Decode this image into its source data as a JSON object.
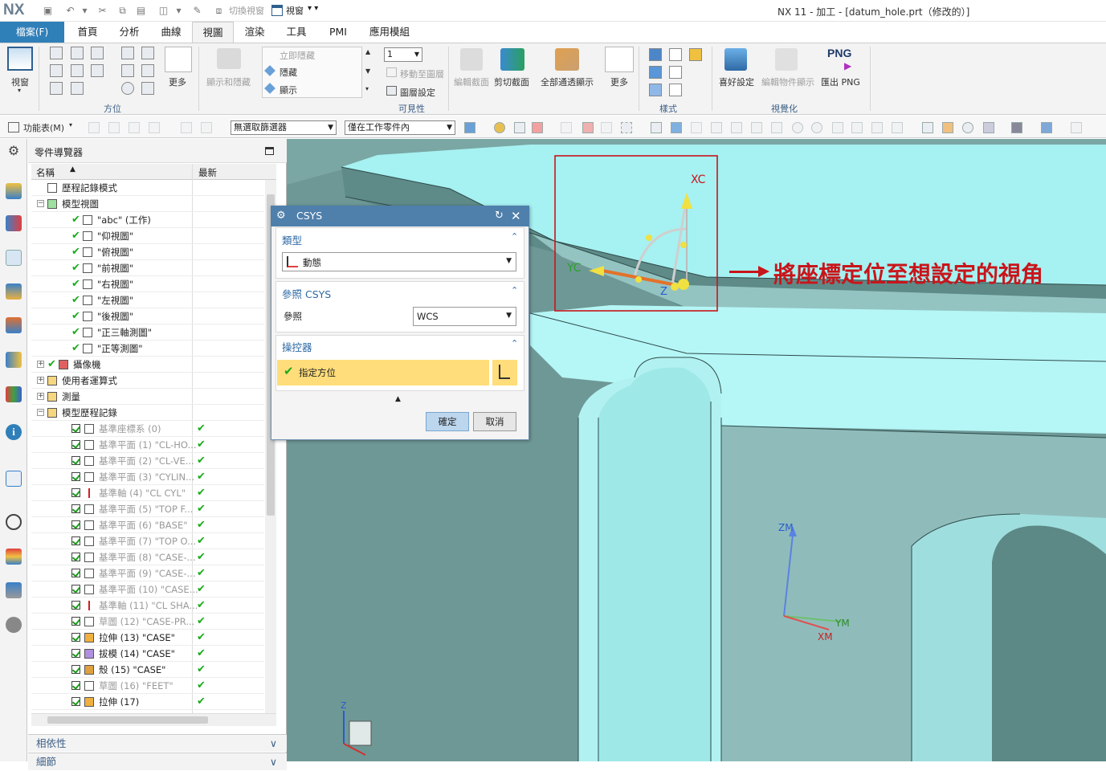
{
  "titlebar": {
    "logo": "NX",
    "quick_access": [
      "save-icon",
      "undo-icon",
      "redo-dropdown-icon",
      "cut-icon",
      "copy-icon",
      "paste-icon",
      "window-icon"
    ],
    "toggle_view_label": "切換視窗",
    "window_label": "視窗",
    "title": "NX 11 - 加工 - [datum_hole.prt（修改的）]"
  },
  "tabs": {
    "file": "檔案(F)",
    "items": [
      "首頁",
      "分析",
      "曲線",
      "視圖",
      "渲染",
      "工具",
      "PMI",
      "應用模組"
    ],
    "active": "視圖"
  },
  "ribbon": {
    "view_button": "視窗",
    "orient_group": "方位",
    "more": "更多",
    "show_hide": "顯示和隱藏",
    "immediate_hide": "立即隱藏",
    "hide": "隱藏",
    "show": "顯示",
    "layer_value": "1",
    "move_to_layer": "移動至圖層",
    "layer_settings": "圖層設定",
    "visibility_group": "可見性",
    "edit_section": "編輯截面",
    "clip_section": "剪切截面",
    "show_all_through": "全部通透顯示",
    "more2": "更多",
    "style_group": "樣式",
    "preferences": "喜好設定",
    "edit_object_display": "編輯物件顯示",
    "png_badge": "PNG",
    "export_png": "匯出 PNG",
    "visualization_group": "視覺化"
  },
  "toolbar": {
    "menu": "功能表(M)",
    "filter": "無選取篩選器",
    "scope": "僅在工作零件內"
  },
  "navigator": {
    "title": "零件導覽器",
    "col_name": "名稱",
    "col_latest": "最新",
    "rows": [
      {
        "label": "歷程記錄模式",
        "indent": 1,
        "icon": "clock-icon"
      },
      {
        "label": "模型視圖",
        "indent": 1,
        "icon": "model-views-icon",
        "exp": "−"
      },
      {
        "label": "\"abc\" (工作)",
        "indent": 3,
        "icon": "view-icon",
        "check": true
      },
      {
        "label": "\"仰視圖\"",
        "indent": 3,
        "icon": "view-icon",
        "check": true
      },
      {
        "label": "\"俯視圖\"",
        "indent": 3,
        "icon": "view-icon",
        "check": true
      },
      {
        "label": "\"前視圖\"",
        "indent": 3,
        "icon": "view-icon",
        "check": true
      },
      {
        "label": "\"右視圖\"",
        "indent": 3,
        "icon": "view-icon",
        "check": true
      },
      {
        "label": "\"左視圖\"",
        "indent": 3,
        "icon": "view-icon",
        "check": true
      },
      {
        "label": "\"後視圖\"",
        "indent": 3,
        "icon": "view-icon",
        "check": true
      },
      {
        "label": "\"正三軸測圖\"",
        "indent": 3,
        "icon": "view-icon",
        "check": true
      },
      {
        "label": "\"正等測圖\"",
        "indent": 3,
        "icon": "view-icon",
        "check": true
      },
      {
        "label": "攝像機",
        "indent": 1,
        "icon": "camera-icon",
        "exp": "+",
        "check": true
      },
      {
        "label": "使用者運算式",
        "indent": 1,
        "icon": "folder-icon",
        "exp": "+"
      },
      {
        "label": "測量",
        "indent": 1,
        "icon": "folder-icon",
        "exp": "+"
      },
      {
        "label": "模型歷程記錄",
        "indent": 1,
        "icon": "folder-icon",
        "exp": "−"
      },
      {
        "label": "基準座標系 (0)",
        "indent": 3,
        "icon": "csys-icon",
        "box": true,
        "grey": true,
        "latest": true
      },
      {
        "label": "基準平面 (1) \"CL-HO...",
        "indent": 3,
        "icon": "plane-icon",
        "box": true,
        "grey": true,
        "latest": true
      },
      {
        "label": "基準平面 (2) \"CL-VE...",
        "indent": 3,
        "icon": "plane-icon",
        "box": true,
        "grey": true,
        "latest": true
      },
      {
        "label": "基準平面 (3) \"CYLIN...",
        "indent": 3,
        "icon": "plane-icon",
        "box": true,
        "grey": true,
        "latest": true
      },
      {
        "label": "基準軸 (4) \"CL CYL\"",
        "indent": 3,
        "icon": "axis-icon",
        "box": true,
        "grey": true,
        "latest": true
      },
      {
        "label": "基準平面 (5) \"TOP F...",
        "indent": 3,
        "icon": "plane-icon",
        "box": true,
        "grey": true,
        "latest": true
      },
      {
        "label": "基準平面 (6) \"BASE\"",
        "indent": 3,
        "icon": "plane-icon",
        "box": true,
        "grey": true,
        "latest": true
      },
      {
        "label": "基準平面 (7) \"TOP O...",
        "indent": 3,
        "icon": "plane-icon",
        "box": true,
        "grey": true,
        "latest": true
      },
      {
        "label": "基準平面 (8) \"CASE-...",
        "indent": 3,
        "icon": "plane-icon",
        "box": true,
        "grey": true,
        "latest": true
      },
      {
        "label": "基準平面 (9) \"CASE-...",
        "indent": 3,
        "icon": "plane-icon",
        "box": true,
        "grey": true,
        "latest": true
      },
      {
        "label": "基準平面 (10) \"CASE...",
        "indent": 3,
        "icon": "plane-icon",
        "box": true,
        "grey": true,
        "latest": true
      },
      {
        "label": "基準軸 (11) \"CL SHA...",
        "indent": 3,
        "icon": "axis-icon",
        "box": true,
        "grey": true,
        "latest": true
      },
      {
        "label": "草圖 (12) \"CASE-PR...",
        "indent": 3,
        "icon": "sketch-icon",
        "box": true,
        "grey": true,
        "latest": true
      },
      {
        "label": "拉伸 (13) \"CASE\"",
        "indent": 3,
        "icon": "extrude-icon",
        "box": true,
        "latest": true
      },
      {
        "label": "拔模 (14) \"CASE\"",
        "indent": 3,
        "icon": "draft-icon",
        "box": true,
        "latest": true
      },
      {
        "label": "殼 (15) \"CASE\"",
        "indent": 3,
        "icon": "shell-icon",
        "box": true,
        "latest": true
      },
      {
        "label": "草圖 (16) \"FEET\"",
        "indent": 3,
        "icon": "sketch-icon",
        "box": true,
        "grey": true,
        "latest": true
      },
      {
        "label": "拉伸 (17)",
        "indent": 3,
        "icon": "extrude-icon",
        "box": true,
        "latest": true
      }
    ],
    "panel_dependencies": "相依性",
    "panel_details": "細節"
  },
  "dialog": {
    "title": "CSYS",
    "type_section": "類型",
    "type_value": "動態",
    "ref_section": "參照 CSYS",
    "ref_label": "參照",
    "ref_value": "WCS",
    "manip_section": "操控器",
    "specify_orient": "指定方位",
    "ok": "確定",
    "cancel": "取消"
  },
  "viewport": {
    "xc": "XC",
    "yc": "YC",
    "zc": "Z",
    "zm": "ZM",
    "ym": "YM",
    "xm": "XM",
    "triad_z": "Z"
  },
  "annotation": "將座標定位至想設定的視角",
  "colors": {
    "accent": "#2f7fb9",
    "annotation": "#c8151b",
    "model_top": "#9ff0f0",
    "model_side": "#6f9a98"
  }
}
